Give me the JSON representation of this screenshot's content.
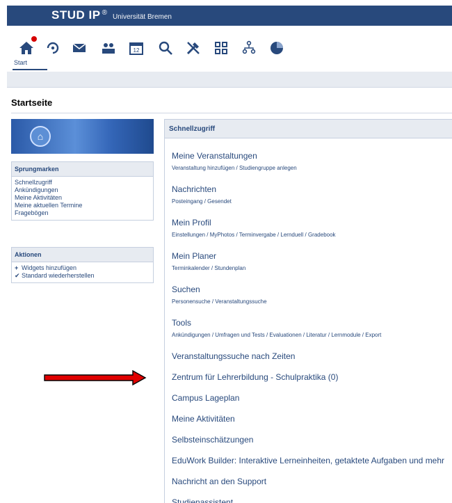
{
  "header": {
    "brand": "STUD IP",
    "brand_mark": "®",
    "university": "Universität Bremen"
  },
  "nav": {
    "items": [
      {
        "name": "start",
        "icon": "home-icon"
      },
      {
        "name": "activity",
        "icon": "activity-icon"
      },
      {
        "name": "messages",
        "icon": "mail-icon"
      },
      {
        "name": "community",
        "icon": "people-icon"
      },
      {
        "name": "planner",
        "icon": "calendar-icon"
      },
      {
        "name": "search",
        "icon": "search-icon"
      },
      {
        "name": "tools",
        "icon": "tools-icon"
      },
      {
        "name": "browse",
        "icon": "browse-icon"
      },
      {
        "name": "groups",
        "icon": "hierarchy-icon"
      },
      {
        "name": "stats",
        "icon": "pie-icon"
      }
    ],
    "start_label": "Start"
  },
  "page": {
    "title": "Startseite"
  },
  "sidebar": {
    "jumpmarks_title": "Sprungmarken",
    "jumpmarks": [
      "Schnellzugriff",
      "Ankündigungen",
      "Meine Aktivitäten",
      "Meine aktuellen Termine",
      "Fragebögen"
    ],
    "actions_title": "Aktionen",
    "actions": [
      {
        "sym": "+",
        "label": "Widgets hinzufügen"
      },
      {
        "sym": "✔",
        "label": "Standard wiederherstellen"
      }
    ]
  },
  "main": {
    "header": "Schnellzugriff",
    "items": [
      {
        "title": "Meine Veranstaltungen",
        "sub": "Veranstaltung hinzufügen / Studiengruppe anlegen"
      },
      {
        "title": "Nachrichten",
        "sub": "Posteingang / Gesendet"
      },
      {
        "title": "Mein Profil",
        "sub": "Einstellungen / MyPhotos / Terminvergabe / Lernduell / Gradebook"
      },
      {
        "title": "Mein Planer",
        "sub": "Terminkalender / Stundenplan"
      },
      {
        "title": "Suchen",
        "sub": "Personensuche / Veranstaltungssuche"
      },
      {
        "title": "Tools",
        "sub": "Ankündigungen / Umfragen und Tests / Evaluationen / Literatur / Lernmodule / Export"
      },
      {
        "title": "Veranstaltungssuche nach Zeiten",
        "sub": ""
      },
      {
        "title": "Zentrum für Lehrerbildung - Schulpraktika (0)",
        "sub": ""
      },
      {
        "title": "Campus Lageplan",
        "sub": ""
      },
      {
        "title": "Meine Aktivitäten",
        "sub": ""
      },
      {
        "title": "Selbsteinschätzungen",
        "sub": ""
      },
      {
        "title": "EduWork Builder: Interaktive Lerneinheiten, getaktete Aufgaben und mehr",
        "sub": ""
      },
      {
        "title": "Nachricht an den Support",
        "sub": ""
      },
      {
        "title": "Studienassistent",
        "sub": ""
      }
    ]
  },
  "colors": {
    "brand": "#28497c",
    "header_bg": "#e7ebf1",
    "arrow": "#e00000",
    "badge": "#d60000"
  }
}
